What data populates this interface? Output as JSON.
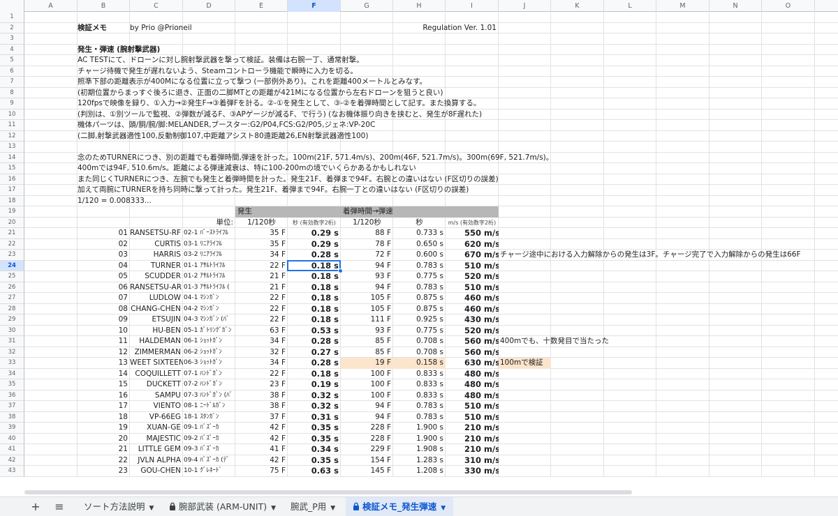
{
  "columns": [
    "A",
    "B",
    "C",
    "D",
    "E",
    "F",
    "G",
    "H",
    "I",
    "J",
    "K",
    "L",
    "M",
    "N",
    "O"
  ],
  "selected_column": "F",
  "selected_row": 24,
  "rows": [
    1,
    2,
    3,
    4,
    5,
    6,
    7,
    8,
    9,
    10,
    11,
    12,
    13,
    14,
    15,
    16,
    17,
    18,
    19,
    20,
    21,
    22,
    23,
    24,
    25,
    26,
    27,
    28,
    29,
    30,
    31,
    32,
    33,
    34,
    35,
    36,
    37,
    38,
    39,
    40,
    41,
    42,
    43
  ],
  "header": {
    "title": "検証メモ",
    "author": "by Prio @Prioneil",
    "regulation": "Regulation Ver. 1.01"
  },
  "notes": {
    "r4": "発生・弾速 (腕射撃武器)",
    "r5": "AC TESTにて、ドローンに対し腕射撃武器を撃って検証。装備は右腕一丁、通常射撃。",
    "r6": "チャージ待機で発生が遅れないよう、Steamコントローラ機能で瞬時に入力を切る。",
    "r7": "照準下部の距離表示が400Mになる位置に立って撃つ (一部例外あり)。これを距離400メートルとみなす。",
    "r8": "(初期位置からまっすぐ後ろに退き、正面の二脚MTとの距離が421Mになる位置から左右ドローンを狙うと良い)",
    "r9": "120fpsで映像を録り、①入力→②発生F→③着弾Fを計る。②-①を発生として、③-②を着弾時間として記す。また換算する。",
    "r10": "(判別は、①別ツールで監視、②弾数が減るF、③APゲージが減るF、で行う) (なお機体振り向きを挟むと、発生が8F遅れた)",
    "r11": "機体パーツは、頭/胴/腕/脚:MELANDER,ブースター:G2/P04,FCS:G2/P05,ジェネ:VP-20C",
    "r12": "(二脚,射撃武器適性100,反動制御107,中距離アシスト80遠距離26,EN射撃武器適性100)",
    "r14": "念のためTURNERにつき、別の距離でも着弾時間,弾速を計った。100m(21F, 571.4m/s)、200m(46F, 521.7m/s)。300m(69F, 521.7m/s)。",
    "r15": "400mでは94F, 510.6m/s。距離による弾速減衰は、特に100-200mの境でいくらかあるかもしれない",
    "r16": "また同じくTURNERにつき、左腕でも発生と着弾時間を計った。発生21F、着弾まで94F。右腕との違いはない (F区切りの誤差)",
    "r17": "加えて両腕にTURNERを持ち同時に撃って計った。発生21F、着弾まで94F。右腕一丁との違いはない (F区切りの誤差)",
    "r18": "1/120 = 0.008333..."
  },
  "table_header": {
    "group_hassei": "発生",
    "group_chakudan": "着弾時間→弾速",
    "unit_label": "単位:",
    "u_frame": "1/120秒",
    "u_sec": "秒",
    "u_sec_note": "(有効数字2桁)",
    "u_frame2": "1/120秒",
    "u_sec2": "秒",
    "u_ms": "m/s",
    "u_ms_note": "(有効数字2桁)"
  },
  "table_rows": [
    {
      "no": "01",
      "name": "RANSETSU-RF",
      "code": "02-1",
      "type": "ﾊﾞｰｽﾄﾗｲﾌﾙ",
      "f1": "35 F",
      "s1": "0.29 s",
      "f2": "88 F",
      "s2": "0.733 s",
      "v": "550 m/s",
      "note": ""
    },
    {
      "no": "02",
      "name": "CURTIS",
      "code": "03-1",
      "type": "ﾘﾆｱﾗｲﾌﾙ",
      "f1": "35 F",
      "s1": "0.29 s",
      "f2": "78 F",
      "s2": "0.650 s",
      "v": "620 m/s",
      "note": ""
    },
    {
      "no": "03",
      "name": "HARRIS",
      "code": "03-2",
      "type": "ﾘﾆｱﾗｲﾌﾙ",
      "f1": "34 F",
      "s1": "0.28 s",
      "f2": "72 F",
      "s2": "0.600 s",
      "v": "670 m/s",
      "note": "チャージ途中における入力解除からの発生は3F。チャージ完了で入力解除からの発生は66F"
    },
    {
      "no": "04",
      "name": "TURNER",
      "code": "01-1",
      "type": "ｱｻﾙﾄﾗｲﾌﾙ",
      "f1": "22 F",
      "s1": "0.18 s",
      "f2": "94 F",
      "s2": "0.783 s",
      "v": "510 m/s",
      "note": ""
    },
    {
      "no": "05",
      "name": "SCUDDER",
      "code": "01-2",
      "type": "ｱｻﾙﾄﾗｲﾌﾙ",
      "f1": "21 F",
      "s1": "0.18 s",
      "f2": "93 F",
      "s2": "0.775 s",
      "v": "520 m/s",
      "note": ""
    },
    {
      "no": "06",
      "name": "RANSETSU-AR",
      "code": "01-3",
      "type": "ｱｻﾙﾄﾗｲﾌﾙ (",
      "f1": "21 F",
      "s1": "0.18 s",
      "f2": "94 F",
      "s2": "0.783 s",
      "v": "510 m/s",
      "note": ""
    },
    {
      "no": "07",
      "name": "LUDLOW",
      "code": "04-1",
      "type": "ﾏｼﾝｶﾞﾝ",
      "f1": "22 F",
      "s1": "0.18 s",
      "f2": "105 F",
      "s2": "0.875 s",
      "v": "460 m/s",
      "note": ""
    },
    {
      "no": "08",
      "name": "CHANG-CHEN",
      "code": "04-2",
      "type": "ﾏｼﾝｶﾞﾝ",
      "f1": "22 F",
      "s1": "0.18 s",
      "f2": "105 F",
      "s2": "0.875 s",
      "v": "460 m/s",
      "note": ""
    },
    {
      "no": "09",
      "name": "ETSUJIN",
      "code": "04-3",
      "type": "ﾏｼﾝｶﾞﾝ (ﾊﾞ",
      "f1": "22 F",
      "s1": "0.18 s",
      "f2": "111 F",
      "s2": "0.925 s",
      "v": "430 m/s",
      "note": ""
    },
    {
      "no": "10",
      "name": "HU-BEN",
      "code": "05-1",
      "type": "ｶﾞﾄﾘﾝｸﾞｶﾞﾝ",
      "f1": "63 F",
      "s1": "0.53 s",
      "f2": "93 F",
      "s2": "0.775 s",
      "v": "520 m/s",
      "note": ""
    },
    {
      "no": "11",
      "name": "HALDEMAN",
      "code": "06-1",
      "type": "ｼｮｯﾄｶﾞﾝ",
      "f1": "34 F",
      "s1": "0.28 s",
      "f2": "85 F",
      "s2": "0.708 s",
      "v": "560 m/s",
      "note": "400mでも、十数発目で当たった"
    },
    {
      "no": "12",
      "name": "ZIMMERMAN",
      "code": "06-2",
      "type": "ｼｮｯﾄｶﾞﾝ",
      "f1": "32 F",
      "s1": "0.27 s",
      "f2": "85 F",
      "s2": "0.708 s",
      "v": "560 m/s",
      "note": ""
    },
    {
      "no": "13",
      "name": "WEET SIXTEEN",
      "code": "06-3",
      "type": "ｼｮｯﾄｶﾞﾝ",
      "f1": "34 F",
      "s1": "0.28 s",
      "f2": "19 F",
      "s2": "0.158 s",
      "v": "630 m/s",
      "note": "100mで検証",
      "hl": true
    },
    {
      "no": "14",
      "name": "COQUILLETT",
      "code": "07-1",
      "type": "ﾊﾝﾄﾞｶﾞﾝ",
      "f1": "22 F",
      "s1": "0.18 s",
      "f2": "100 F",
      "s2": "0.833 s",
      "v": "480 m/s",
      "note": ""
    },
    {
      "no": "15",
      "name": "DUCKETT",
      "code": "07-2",
      "type": "ﾊﾝﾄﾞｶﾞﾝ",
      "f1": "23 F",
      "s1": "0.19 s",
      "f2": "100 F",
      "s2": "0.833 s",
      "v": "480 m/s",
      "note": ""
    },
    {
      "no": "16",
      "name": "SAMPU",
      "code": "07-3",
      "type": "ﾊﾝﾄﾞｶﾞﾝ (ﾊﾞ",
      "f1": "38 F",
      "s1": "0.32 s",
      "f2": "100 F",
      "s2": "0.833 s",
      "v": "480 m/s",
      "note": ""
    },
    {
      "no": "17",
      "name": "VIENTO",
      "code": "08-1",
      "type": "ﾆｰﾄﾞﾙｶﾞﾝ",
      "f1": "38 F",
      "s1": "0.32 s",
      "f2": "94 F",
      "s2": "0.783 s",
      "v": "510 m/s",
      "note": ""
    },
    {
      "no": "18",
      "name": "VP-66EG",
      "code": "18-1",
      "type": "ｽﾀﾝｶﾞﾝ",
      "f1": "37 F",
      "s1": "0.31 s",
      "f2": "94 F",
      "s2": "0.783 s",
      "v": "510 m/s",
      "note": ""
    },
    {
      "no": "19",
      "name": "XUAN-GE",
      "code": "09-1",
      "type": "ﾊﾞｽﾞｰｶ",
      "f1": "42 F",
      "s1": "0.35 s",
      "f2": "228 F",
      "s2": "1.900 s",
      "v": "210 m/s",
      "note": ""
    },
    {
      "no": "20",
      "name": "MAJESTIC",
      "code": "09-2",
      "type": "ﾊﾞｽﾞｰｶ",
      "f1": "42 F",
      "s1": "0.35 s",
      "f2": "228 F",
      "s2": "1.900 s",
      "v": "210 m/s",
      "note": ""
    },
    {
      "no": "21",
      "name": "LITTLE GEM",
      "code": "09-3",
      "type": "ﾊﾞｽﾞｰｶ",
      "f1": "41 F",
      "s1": "0.34 s",
      "f2": "229 F",
      "s2": "1.908 s",
      "v": "210 m/s",
      "note": ""
    },
    {
      "no": "22",
      "name": "JVLN ALPHA",
      "code": "09-4",
      "type": "ﾊﾞｽﾞｰｶ (ﾃﾞ",
      "f1": "42 F",
      "s1": "0.35 s",
      "f2": "154 F",
      "s2": "1.283 s",
      "v": "310 m/s",
      "note": ""
    },
    {
      "no": "23",
      "name": "GOU-CHEN",
      "code": "10-1",
      "type": "ｸﾞﾚﾈｰﾄﾞ",
      "f1": "75 F",
      "s1": "0.63 s",
      "f2": "145 F",
      "s2": "1.208 s",
      "v": "330 m/s",
      "note": ""
    }
  ],
  "tabs": [
    {
      "label": "ソート方法説明",
      "locked": false,
      "active": false
    },
    {
      "label": "腕部武装 (ARM-UNIT)",
      "locked": true,
      "active": false
    },
    {
      "label": "腕武_P用",
      "locked": false,
      "active": false
    },
    {
      "label": "検証メモ_発生弾速",
      "locked": true,
      "active": true
    }
  ],
  "toolbar": {
    "add_label": "+",
    "menu_label": "≡"
  },
  "colors": {
    "header_gray": "#b7b7b7",
    "highlight": "#fce5cd",
    "selection": "#1a73e8"
  }
}
